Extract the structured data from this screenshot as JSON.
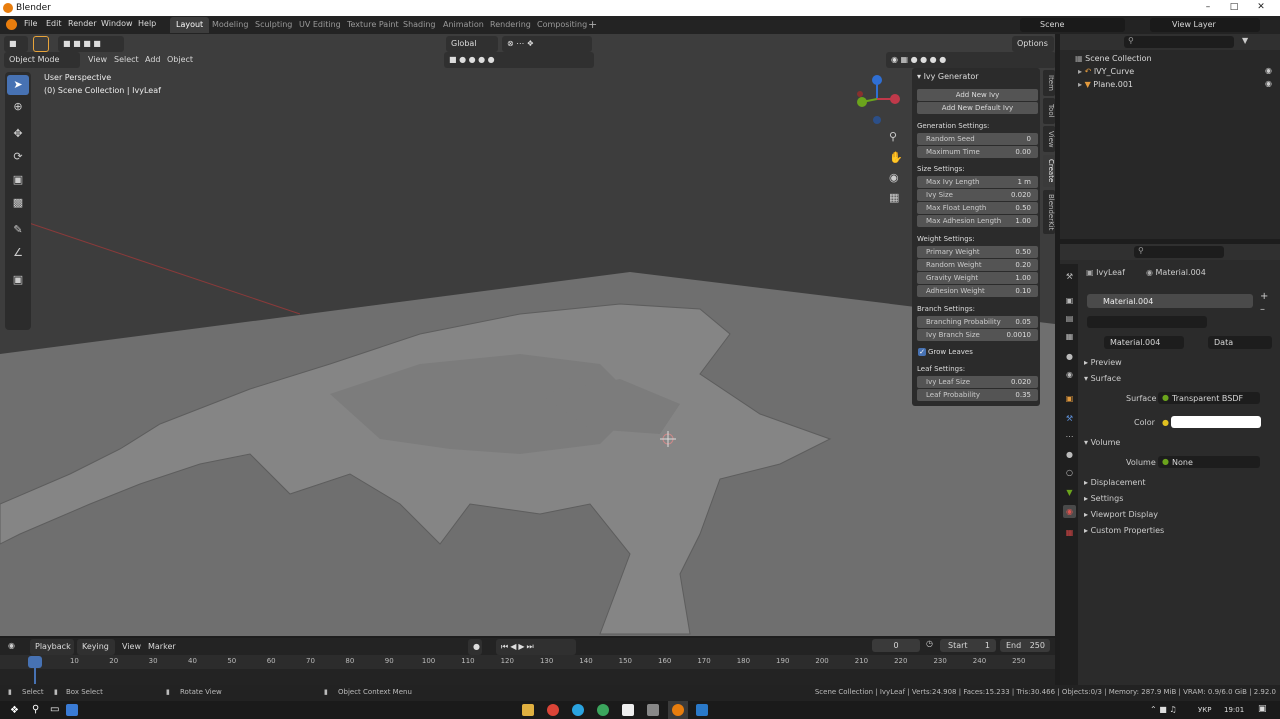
{
  "window": {
    "title": "Blender"
  },
  "menu": [
    "File",
    "Edit",
    "Render",
    "Window",
    "Help"
  ],
  "workspaces": [
    "Layout",
    "Modeling",
    "Sculpting",
    "UV Editing",
    "Texture Paint",
    "Shading",
    "Animation",
    "Rendering",
    "Compositing"
  ],
  "scene": {
    "name": "Scene",
    "view_layer": "View Layer"
  },
  "viewport": {
    "mode": "Object Mode",
    "menus": [
      "View",
      "Select",
      "Add",
      "Object"
    ],
    "orientation": "Global",
    "options": "Options",
    "overlay_line1": "User Perspective",
    "overlay_line2": "(0) Scene Collection | IvyLeaf"
  },
  "ivy": {
    "title": "Ivy Generator",
    "add_new": "Add New Ivy",
    "add_default": "Add New Default Ivy",
    "gen_head": "Generation Settings:",
    "gen": [
      {
        "l": "Random Seed",
        "v": "0"
      },
      {
        "l": "Maximum Time",
        "v": "0.00"
      }
    ],
    "size_head": "Size Settings:",
    "size": [
      {
        "l": "Max Ivy Length",
        "v": "1 m"
      },
      {
        "l": "Ivy Size",
        "v": "0.020"
      },
      {
        "l": "Max Float Length",
        "v": "0.50"
      },
      {
        "l": "Max Adhesion Length",
        "v": "1.00"
      }
    ],
    "weight_head": "Weight Settings:",
    "weight": [
      {
        "l": "Primary Weight",
        "v": "0.50"
      },
      {
        "l": "Random Weight",
        "v": "0.20"
      },
      {
        "l": "Gravity Weight",
        "v": "1.00"
      },
      {
        "l": "Adhesion Weight",
        "v": "0.10"
      }
    ],
    "branch_head": "Branch Settings:",
    "branch": [
      {
        "l": "Branching Probability",
        "v": "0.05"
      },
      {
        "l": "Ivy Branch Size",
        "v": "0.0010"
      }
    ],
    "grow_leaves": "Grow Leaves",
    "leaf_head": "Leaf Settings:",
    "leaf": [
      {
        "l": "Ivy Leaf Size",
        "v": "0.020"
      },
      {
        "l": "Leaf Probability",
        "v": "0.35"
      }
    ]
  },
  "sidetabs": [
    "Item",
    "Tool",
    "View",
    "Create",
    "BlenderKit"
  ],
  "outliner": {
    "root": "Scene Collection",
    "items": [
      "IVY_Curve",
      "Plane.001"
    ]
  },
  "properties": {
    "object": "IvyLeaf",
    "material": "Material.004",
    "slot": "Material.004",
    "data": "Data",
    "preview": "Preview",
    "surface_head": "Surface",
    "surface_label": "Surface",
    "surface_value": "Transparent BSDF",
    "color_label": "Color",
    "color_value": "#ffffff",
    "volume_head": "Volume",
    "volume_label": "Volume",
    "volume_value": "None",
    "sections": [
      "Displacement",
      "Settings",
      "Viewport Display",
      "Custom Properties"
    ]
  },
  "timeline": {
    "menus": [
      "Playback",
      "Keying",
      "View",
      "Marker"
    ],
    "current": "0",
    "start_label": "Start",
    "start": "1",
    "end_label": "End",
    "end": "250",
    "ticks": [
      "0",
      "10",
      "20",
      "30",
      "40",
      "50",
      "60",
      "70",
      "80",
      "90",
      "100",
      "110",
      "120",
      "130",
      "140",
      "150",
      "160",
      "170",
      "180",
      "190",
      "200",
      "210",
      "220",
      "230",
      "240",
      "250"
    ]
  },
  "status": {
    "select": "Select",
    "box": "Box Select",
    "rotate": "Rotate View",
    "ctx": "Object Context Menu",
    "info": "Scene Collection | IvyLeaf | Verts:24.908 | Faces:15.233 | Tris:30.466 | Objects:0/3 | Memory: 287.9 MiB | VRAM: 0.9/6.0 GiB | 2.92.0"
  },
  "taskbar": {
    "lang": "УКР",
    "time": "19:01"
  }
}
